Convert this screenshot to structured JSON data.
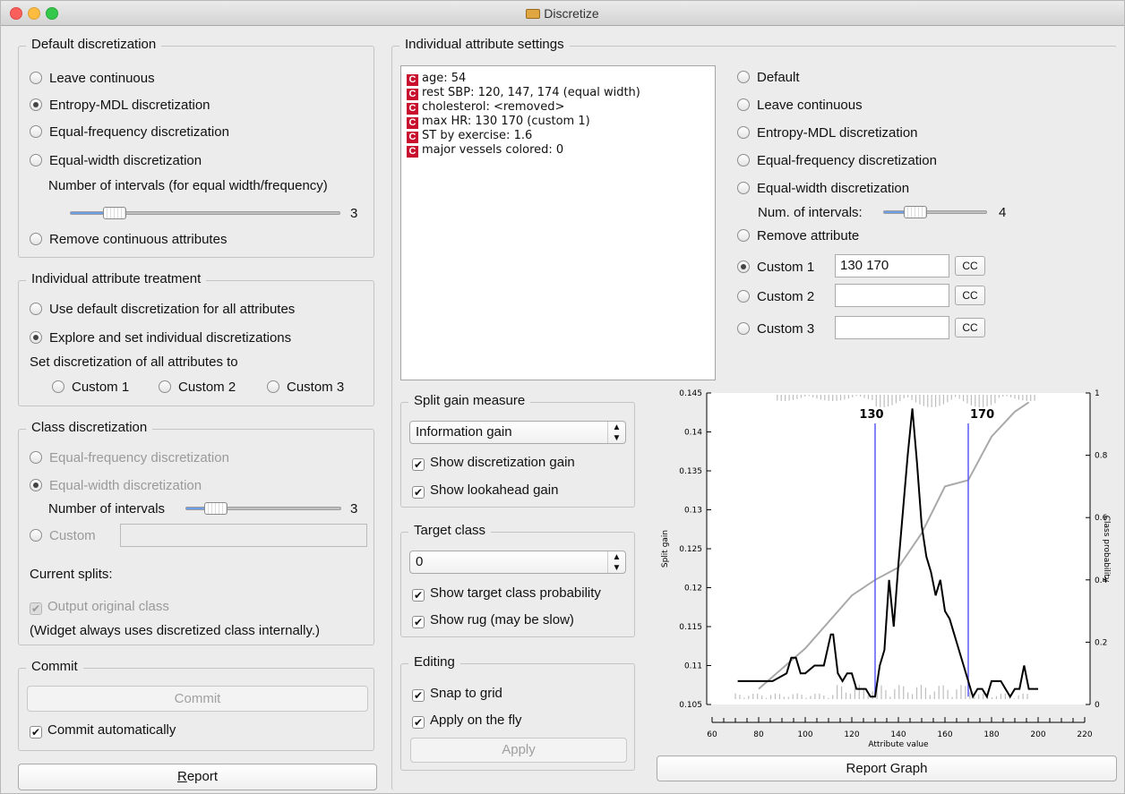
{
  "window": {
    "title": "Discretize"
  },
  "default_disc": {
    "title": "Default discretization",
    "options": [
      "Leave continuous",
      "Entropy-MDL discretization",
      "Equal-frequency discretization",
      "Equal-width discretization"
    ],
    "selected": 1,
    "intervals_label": "Number of intervals (for equal width/frequency)",
    "intervals_value": "3",
    "remove_label": "Remove continuous attributes"
  },
  "indiv_treat": {
    "title": "Individual attribute treatment",
    "options": [
      "Use default discretization for all attributes",
      "Explore and set individual discretizations"
    ],
    "selected": 1,
    "set_all_label": "Set discretization of all attributes to",
    "custom": [
      "Custom 1",
      "Custom 2",
      "Custom 3"
    ]
  },
  "class_disc": {
    "title": "Class discretization",
    "options": [
      "Equal-frequency discretization",
      "Equal-width discretization"
    ],
    "intervals_label": "Number of intervals",
    "intervals_value": "3",
    "custom_label": "Custom",
    "current_splits": "Current splits:",
    "output_original": "Output original class",
    "note": "(Widget always uses discretized class internally.)"
  },
  "commit": {
    "title": "Commit",
    "button": "Commit",
    "auto": "Commit automatically"
  },
  "report": {
    "button_prefix": "R",
    "button_rest": "eport"
  },
  "indiv_settings": {
    "title": "Individual attribute settings",
    "badge": "C",
    "attributes": [
      "age: 54",
      "rest SBP: 120, 147, 174 (equal width)",
      "cholesterol: <removed>",
      "max HR: 130 170 (custom 1)",
      "ST by exercise: 1.6",
      "major vessels colored: 0"
    ],
    "options": [
      "Default",
      "Leave continuous",
      "Entropy-MDL discretization",
      "Equal-frequency discretization",
      "Equal-width discretization"
    ],
    "num_intervals_label": "Num. of intervals:",
    "num_intervals_value": "4",
    "remove_label": "Remove attribute",
    "customs": [
      {
        "label": "Custom 1",
        "value": "130 170",
        "selected": true
      },
      {
        "label": "Custom 2",
        "value": "",
        "selected": false
      },
      {
        "label": "Custom 3",
        "value": "",
        "selected": false
      }
    ],
    "cc": "CC"
  },
  "split_gain": {
    "title": "Split gain measure",
    "selected": "Information gain",
    "show_disc_gain": "Show discretization gain",
    "show_lookahead": "Show lookahead gain"
  },
  "target": {
    "title": "Target class",
    "selected": "0",
    "show_prob": "Show target class probability",
    "show_rug": "Show rug (may be slow)"
  },
  "editing": {
    "title": "Editing",
    "snap": "Snap to grid",
    "apply_fly": "Apply on the fly",
    "apply": "Apply"
  },
  "report_graph": "Report Graph",
  "colors": {
    "split_line": "#5b5bf5",
    "gain_line": "#000000",
    "prob_line": "#a9a9a9",
    "rug": "#bdbdbd",
    "badge": "#c8102e"
  },
  "chart_data": {
    "type": "line",
    "xlabel": "Attribute value",
    "ylabel": "Split gain",
    "y2label": "Class probability",
    "xlim": [
      60,
      220
    ],
    "ylim": [
      0.105,
      0.145
    ],
    "y2lim": [
      0,
      1
    ],
    "x_ticks": [
      60,
      80,
      100,
      120,
      140,
      160,
      180,
      200,
      220
    ],
    "y_ticks": [
      0.105,
      0.11,
      0.115,
      0.12,
      0.125,
      0.13,
      0.135,
      0.14,
      0.145
    ],
    "y2_ticks": [
      0,
      0.2,
      0.4,
      0.6,
      0.8,
      1
    ],
    "splits": [
      130,
      170
    ],
    "series": [
      {
        "name": "Split gain",
        "x": [
          71,
          86,
          92,
          94,
          96,
          98,
          100,
          104,
          106,
          108,
          111,
          112,
          114,
          116,
          118,
          120,
          122,
          126,
          128,
          130,
          132,
          134,
          136,
          138,
          140,
          142,
          144,
          146,
          148,
          150,
          152,
          154,
          156,
          158,
          160,
          162,
          164,
          166,
          168,
          170,
          172,
          174,
          176,
          178,
          180,
          182,
          184,
          186,
          188,
          190,
          192,
          194,
          196,
          200
        ],
        "values": [
          0.108,
          0.108,
          0.109,
          0.111,
          0.111,
          0.109,
          0.109,
          0.11,
          0.11,
          0.11,
          0.114,
          0.114,
          0.109,
          0.108,
          0.109,
          0.109,
          0.107,
          0.107,
          0.106,
          0.106,
          0.11,
          0.112,
          0.121,
          0.115,
          0.123,
          0.13,
          0.137,
          0.143,
          0.136,
          0.128,
          0.124,
          0.122,
          0.119,
          0.121,
          0.117,
          0.116,
          0.114,
          0.112,
          0.11,
          0.108,
          0.106,
          0.107,
          0.107,
          0.106,
          0.108,
          0.108,
          0.108,
          0.107,
          0.106,
          0.107,
          0.107,
          0.11,
          0.107,
          0.107
        ]
      },
      {
        "name": "Class probability",
        "x": [
          80,
          100,
          120,
          130,
          140,
          150,
          160,
          170,
          180,
          190,
          196
        ],
        "values": [
          0.05,
          0.18,
          0.35,
          0.4,
          0.44,
          0.55,
          0.7,
          0.72,
          0.86,
          0.94,
          0.97
        ]
      }
    ]
  }
}
